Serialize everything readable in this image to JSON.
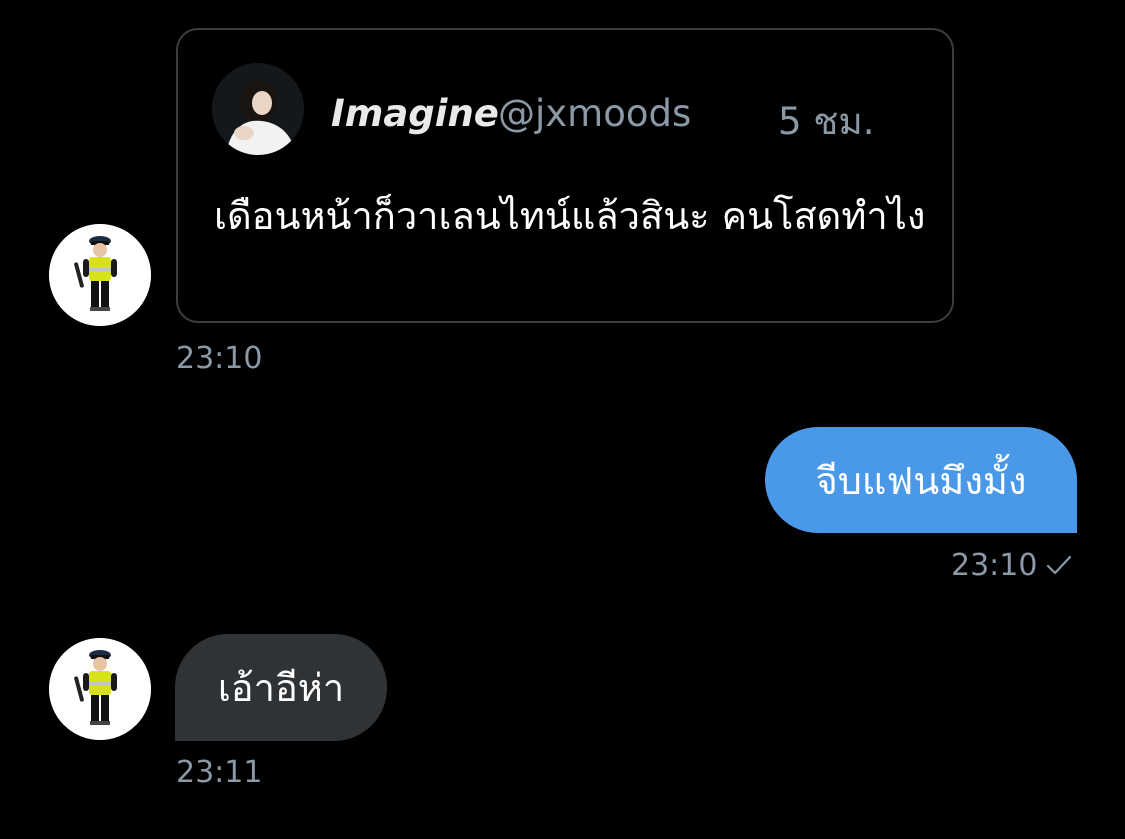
{
  "quoted_tweet": {
    "author_name": "Imagine",
    "author_handle": "@jxmoods",
    "time_ago": "5 ชม.",
    "text": "เดือนหน้าก็วาเลนไทน์แล้วสินะ คนโสดทำไง",
    "avatar_icon": "profile-photo-icon"
  },
  "messages": [
    {
      "direction": "incoming",
      "type": "shared_tweet",
      "timestamp": "23:10",
      "avatar_icon": "police-costume-avatar-icon"
    },
    {
      "direction": "outgoing",
      "text": "จีบแฟนมึงมั้ง",
      "timestamp": "23:10",
      "status_icon": "check-icon",
      "bubble_color": "#4a99e9"
    },
    {
      "direction": "incoming",
      "text": "เอ้าอีห่า",
      "timestamp": "23:11",
      "avatar_icon": "police-costume-avatar-icon",
      "bubble_color": "#2f3336"
    }
  ],
  "colors": {
    "background": "#000000",
    "muted_text": "#8b98a5",
    "card_border": "#3a3d41"
  }
}
